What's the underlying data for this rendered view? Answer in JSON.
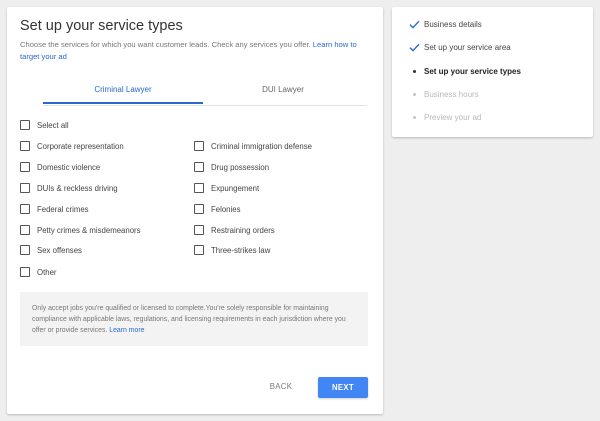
{
  "title": "Set up your service types",
  "description": "Choose the services for which you want customer leads. Check any services you offer.",
  "description_link": "Learn how to target your ad",
  "tabs": [
    {
      "label": "Criminal Lawyer",
      "active": true
    },
    {
      "label": "DUI Lawyer",
      "active": false
    }
  ],
  "select_all": "Select all",
  "services_left": [
    "Corporate representation",
    "Domestic violence",
    "DUIs & reckless driving",
    "Federal crimes",
    "Petty crimes & misdemeanors",
    "Sex offenses",
    "Other"
  ],
  "services_right": [
    "Criminal immigration defense",
    "Drug possession",
    "Expungement",
    "Felonies",
    "Restraining orders",
    "Three-strikes law"
  ],
  "notice": {
    "text": "Only accept jobs you're qualified or licensed to complete.You're solely responsible for maintaining compliance with applicable laws, regulations, and licensing requirements in each jurisdiction where you offer or provide services.",
    "link": "Learn more"
  },
  "buttons": {
    "back": "BACK",
    "next": "NEXT"
  },
  "steps": [
    {
      "label": "Business details",
      "status": "done"
    },
    {
      "label": "Set up your service area",
      "status": "done"
    },
    {
      "label": "Set up your service types",
      "status": "current"
    },
    {
      "label": "Business hours",
      "status": "todo"
    },
    {
      "label": "Preview your ad",
      "status": "todo"
    }
  ],
  "colors": {
    "accent": "#4285f4",
    "link": "#2a67d2",
    "check": "#2a67d2"
  }
}
